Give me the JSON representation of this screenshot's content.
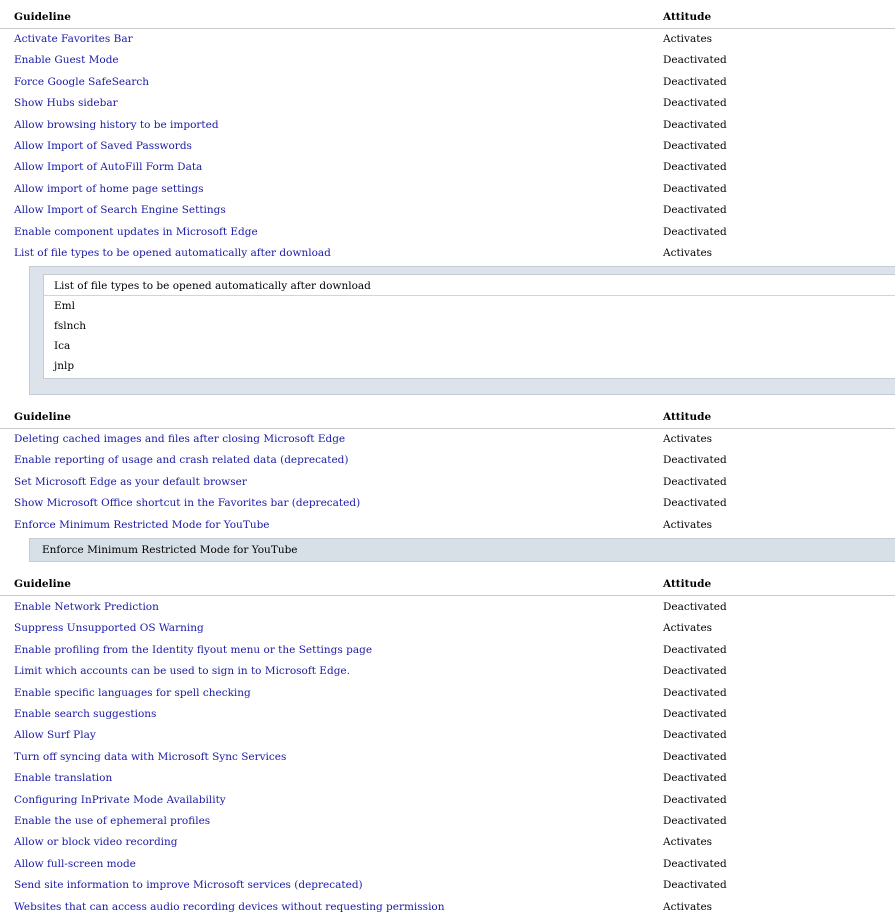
{
  "columns": {
    "guideline": "Guideline",
    "attitude": "Attitude"
  },
  "section1": {
    "rows": [
      {
        "name": "Activate Favorites Bar",
        "state": "Activates"
      },
      {
        "name": "Enable Guest Mode",
        "state": "Deactivated"
      },
      {
        "name": "Force Google SafeSearch",
        "state": "Deactivated"
      },
      {
        "name": "Show Hubs sidebar",
        "state": "Deactivated"
      },
      {
        "name": "Allow browsing history to be imported",
        "state": "Deactivated"
      },
      {
        "name": "Allow Import of Saved Passwords",
        "state": "Deactivated"
      },
      {
        "name": "Allow Import of AutoFill Form Data",
        "state": "Deactivated"
      },
      {
        "name": "Allow import of home page settings",
        "state": "Deactivated"
      },
      {
        "name": "Allow Import of Search Engine Settings",
        "state": "Deactivated"
      },
      {
        "name": "Enable component updates in Microsoft Edge",
        "state": "Deactivated"
      },
      {
        "name": "List of file types to be opened automatically after download",
        "state": "Activates"
      }
    ],
    "file_types_panel": {
      "header": "List of file types to be opened automatically after download",
      "items": [
        "Eml",
        "fslnch",
        "Ica",
        "jnlp"
      ]
    }
  },
  "section2": {
    "rows": [
      {
        "name": "Deleting cached images and files after closing Microsoft Edge",
        "state": "Activates"
      },
      {
        "name": "Enable reporting of usage and crash related data (deprecated)",
        "state": "Deactivated"
      },
      {
        "name": "Set Microsoft Edge as your default browser",
        "state": "Deactivated"
      },
      {
        "name": "Show Microsoft Office shortcut in the Favorites bar (deprecated)",
        "state": "Deactivated"
      },
      {
        "name": "Enforce Minimum Restricted Mode for YouTube",
        "state": "Activates"
      }
    ],
    "youtube_panel": {
      "label": "Enforce Minimum Restricted Mode for YouTube"
    }
  },
  "section3": {
    "rows": [
      {
        "name": "Enable Network Prediction",
        "state": "Deactivated"
      },
      {
        "name": "Suppress Unsupported OS Warning",
        "state": "Activates"
      },
      {
        "name": "Enable profiling from the Identity flyout menu or the Settings page",
        "state": "Deactivated"
      },
      {
        "name": "Limit which accounts can be used to sign in to Microsoft Edge.",
        "state": "Deactivated"
      },
      {
        "name": "Enable specific languages for spell checking",
        "state": "Deactivated"
      },
      {
        "name": "Enable search suggestions",
        "state": "Deactivated"
      },
      {
        "name": "Allow Surf Play",
        "state": "Deactivated"
      },
      {
        "name": "Turn off syncing data with Microsoft Sync Services",
        "state": "Deactivated"
      },
      {
        "name": "Enable translation",
        "state": "Deactivated"
      },
      {
        "name": "Configuring InPrivate Mode Availability",
        "state": "Deactivated"
      },
      {
        "name": "Enable the use of ephemeral profiles",
        "state": "Deactivated"
      },
      {
        "name": "Allow or block video recording",
        "state": "Activates"
      },
      {
        "name": "Allow full-screen mode",
        "state": "Deactivated"
      },
      {
        "name": "Send site information to improve Microsoft services (deprecated)",
        "state": "Deactivated"
      },
      {
        "name": "Websites that can access audio recording devices without requesting permission",
        "state": "Activates"
      }
    ]
  }
}
